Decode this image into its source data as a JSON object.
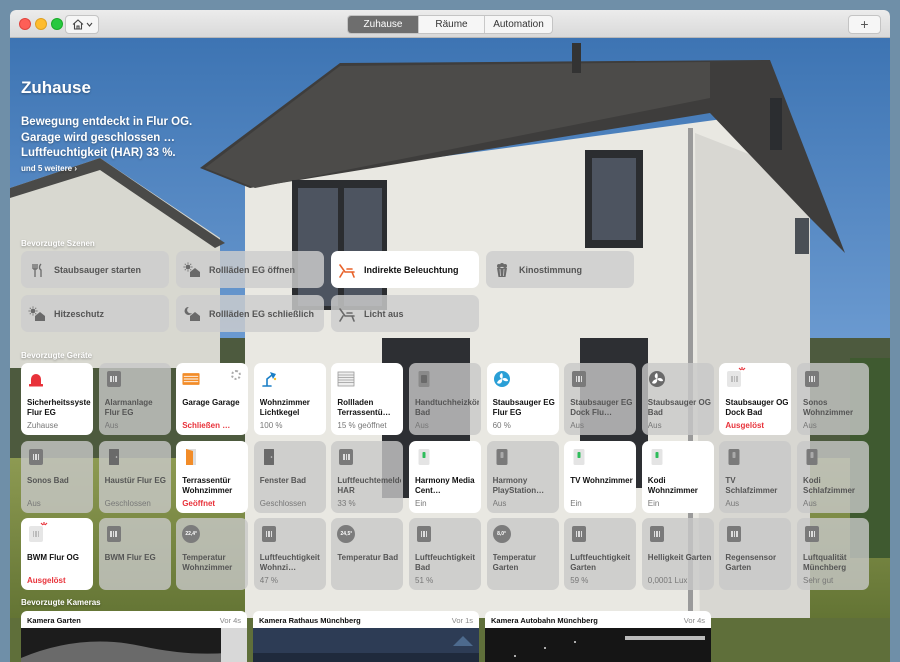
{
  "titlebar": {
    "tabs": [
      {
        "label": "Zuhause",
        "active": true
      },
      {
        "label": "Räume",
        "active": false
      },
      {
        "label": "Automation",
        "active": false
      }
    ],
    "add_label": "+"
  },
  "header": {
    "title": "Zuhause",
    "status_lines": [
      "Bewegung entdeckt in Flur OG.",
      "Garage wird geschlossen …",
      "Luftfeuchtigkeit (HAR) 33 %."
    ],
    "more_link": "und 5 weitere ›"
  },
  "sections": {
    "scenes": "Bevorzugte Szenen",
    "devices": "Bevorzugte Geräte",
    "cameras": "Bevorzugte Kameras"
  },
  "scenes": [
    {
      "label": "Staubsauger starten",
      "icon": "fork-knife-icon",
      "active": false
    },
    {
      "label": "Rollläden EG öffnen",
      "icon": "house-sun-icon",
      "active": false
    },
    {
      "label": "Indirekte Beleuchtung",
      "icon": "lounge-chair-icon",
      "active": true
    },
    {
      "label": "Kinostimmung",
      "icon": "popcorn-icon",
      "active": false
    },
    {
      "label": "Hitzeschutz",
      "icon": "house-sun-icon",
      "active": false
    },
    {
      "label": "Rollläden EG schließlich",
      "icon": "house-moon-icon",
      "active": false
    },
    {
      "label": "Licht aus",
      "icon": "lounge-chair-icon",
      "active": false
    }
  ],
  "devices": [
    {
      "name": "Sicherheitssystem Flur EG",
      "status": "Zuhause",
      "icon": "alarm-siren-icon",
      "on": true,
      "red": false
    },
    {
      "name": "Alarmanlage Flur EG",
      "status": "Aus",
      "icon": "device-icon",
      "on": false,
      "red": false
    },
    {
      "name": "Garage Garage",
      "status": "Schließen …",
      "icon": "garage-door-icon",
      "on": true,
      "red": true
    },
    {
      "name": "Wohnzimmer Lichtkegel",
      "status": "100 %",
      "icon": "desk-lamp-icon",
      "on": true,
      "red": false
    },
    {
      "name": "Rollladen Terrassentü…",
      "status": "15 % geöffnet",
      "icon": "blinds-icon",
      "on": true,
      "red": false
    },
    {
      "name": "Handtuchheizkörper Bad",
      "status": "Aus",
      "icon": "plug-icon",
      "on": false,
      "red": false
    },
    {
      "name": "Staubsauger EG Flur EG",
      "status": "60 %",
      "icon": "fan-icon",
      "on": true,
      "red": false
    },
    {
      "name": "Staubsauger EG Dock Flu…",
      "status": "Aus",
      "icon": "device-icon",
      "on": false,
      "red": false
    },
    {
      "name": "Staubsauger OG Bad",
      "status": "Aus",
      "icon": "fan-icon",
      "on": false,
      "red": false
    },
    {
      "name": "Staubsauger OG Dock Bad",
      "status": "Ausgelöst",
      "icon": "device-alert-icon",
      "on": true,
      "red": true
    },
    {
      "name": "Sonos Wohnzimmer",
      "status": "Aus",
      "icon": "device-icon",
      "on": false,
      "red": false
    },
    {
      "name": "Sonos Bad",
      "status": "Aus",
      "icon": "device-icon",
      "on": false,
      "red": false
    },
    {
      "name": "Haustür Flur EG",
      "status": "Geschlossen",
      "icon": "door-icon",
      "on": false,
      "red": false
    },
    {
      "name": "Terrassentür Wohnzimmer",
      "status": "Geöffnet",
      "icon": "door-open-icon",
      "on": true,
      "red": true
    },
    {
      "name": "Fenster Bad",
      "status": "Geschlossen",
      "icon": "door-icon",
      "on": false,
      "red": false
    },
    {
      "name": "Luftfeuchtemelder HAR",
      "status": "33 %",
      "icon": "device-icon",
      "on": false,
      "red": false
    },
    {
      "name": "Harmony Media Cent…",
      "status": "Ein",
      "icon": "switch-icon",
      "on": true,
      "red": false
    },
    {
      "name": "Harmony PlayStation…",
      "status": "Aus",
      "icon": "switch-icon",
      "on": false,
      "red": false
    },
    {
      "name": "TV Wohnzimmer",
      "status": "Ein",
      "icon": "switch-icon",
      "on": true,
      "red": false
    },
    {
      "name": "Kodi Wohnzimmer",
      "status": "Ein",
      "icon": "switch-icon",
      "on": true,
      "red": false
    },
    {
      "name": "TV Schlafzimmer",
      "status": "Aus",
      "icon": "switch-icon",
      "on": false,
      "red": false
    },
    {
      "name": "Kodi Schlafzimmer",
      "status": "Aus",
      "icon": "switch-icon",
      "on": false,
      "red": false
    },
    {
      "name": "BWM Flur OG",
      "status": "Ausgelöst",
      "icon": "device-alert-icon",
      "on": true,
      "red": true
    },
    {
      "name": "BWM Flur EG",
      "status": "",
      "icon": "device-icon",
      "on": false,
      "red": false
    },
    {
      "name": "Temperatur Wohnzimmer",
      "status": "",
      "icon": "temperature-icon",
      "on": false,
      "red": false,
      "reading": "22,4°"
    },
    {
      "name": "Luftfeuchtigkeit Wohnzi…",
      "status": "47 %",
      "icon": "device-icon",
      "on": false,
      "red": false
    },
    {
      "name": "Temperatur Bad",
      "status": "",
      "icon": "temperature-icon",
      "on": false,
      "red": false,
      "reading": "24,5°"
    },
    {
      "name": "Luftfeuchtigkeit Bad",
      "status": "51 %",
      "icon": "device-icon",
      "on": false,
      "red": false
    },
    {
      "name": "Temperatur Garten",
      "status": "",
      "icon": "temperature-icon",
      "on": false,
      "red": false,
      "reading": "8,0°"
    },
    {
      "name": "Luftfeuchtigkeit Garten",
      "status": "59 %",
      "icon": "device-icon",
      "on": false,
      "red": false
    },
    {
      "name": "Helligkeit Garten",
      "status": "0,0001 Lux",
      "icon": "device-icon",
      "on": false,
      "red": false
    },
    {
      "name": "Regensensor Garten",
      "status": "",
      "icon": "device-icon",
      "on": false,
      "red": false
    },
    {
      "name": "Luftqualität Münchberg",
      "status": "Sehr gut",
      "icon": "device-icon",
      "on": false,
      "red": false
    }
  ],
  "cameras": [
    {
      "title": "Kamera Garten",
      "age": "Vor 4s"
    },
    {
      "title": "Kamera Rathaus Münchberg",
      "age": "Vor 1s"
    },
    {
      "title": "Kamera Autobahn Münchberg",
      "age": "Vor 4s"
    }
  ],
  "colors": {
    "alert_red": "#e8323a",
    "active_tab": "#6e6e6e",
    "tile_on": "#ffffff",
    "tile_off": "#c8c8c8"
  }
}
